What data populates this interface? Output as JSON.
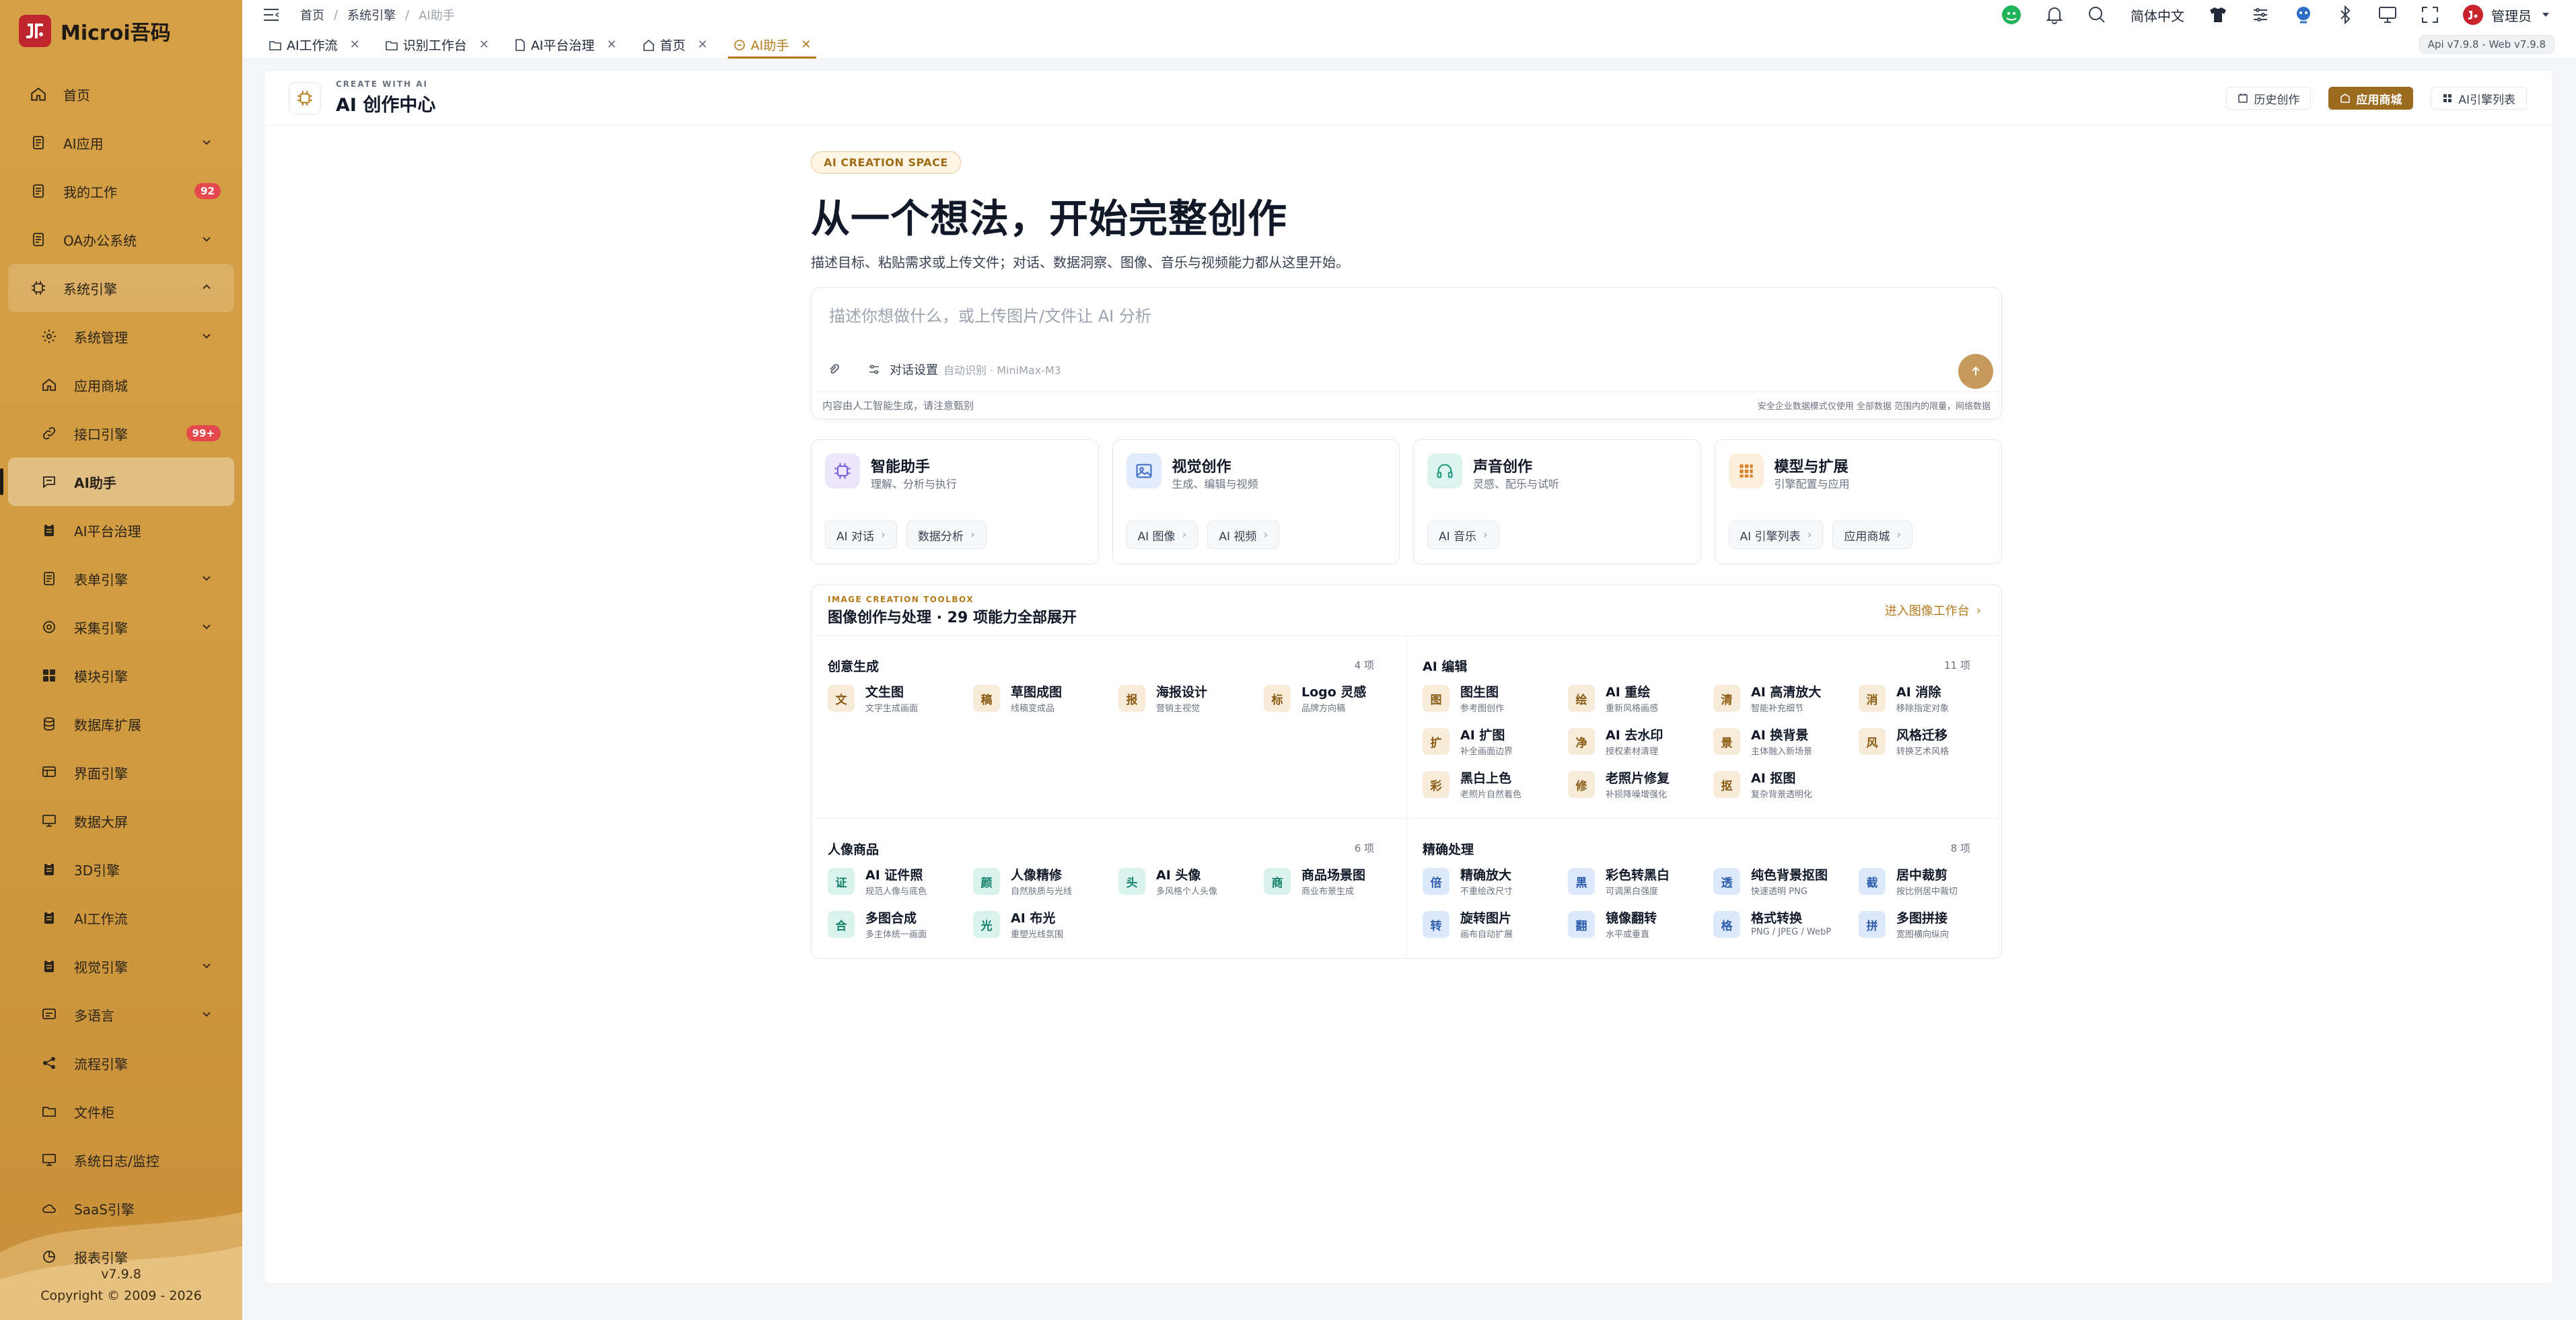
{
  "brand": {
    "name": "Microi吾码"
  },
  "sidebar": {
    "items": [
      {
        "label": "首页",
        "icon": "home-icon"
      },
      {
        "label": "AI应用",
        "icon": "document-icon",
        "chevron": true
      },
      {
        "label": "我的工作",
        "icon": "document-icon",
        "badge": "92"
      },
      {
        "label": "OA办公系统",
        "icon": "document-icon",
        "chevron": true
      },
      {
        "label": "系统引擎",
        "icon": "chip-icon",
        "chevron": true
      },
      {
        "label": "系统管理",
        "icon": "gear-icon",
        "chevron": true
      },
      {
        "label": "应用商城",
        "icon": "home-icon"
      },
      {
        "label": "接口引擎",
        "icon": "link-icon",
        "badge": "99+"
      },
      {
        "label": "AI助手",
        "icon": "chat-icon"
      },
      {
        "label": "AI平台治理",
        "icon": "clipboard-icon"
      },
      {
        "label": "表单引擎",
        "icon": "document-icon",
        "chevron": true
      },
      {
        "label": "采集引擎",
        "icon": "gear-icon",
        "chevron": true
      },
      {
        "label": "模块引擎",
        "icon": "grid-icon"
      },
      {
        "label": "数据库扩展",
        "icon": "database-icon"
      },
      {
        "label": "界面引擎",
        "icon": "layout-icon"
      },
      {
        "label": "数据大屏",
        "icon": "monitor-icon"
      },
      {
        "label": "3D引擎",
        "icon": "clipboard-icon"
      },
      {
        "label": "AI工作流",
        "icon": "clipboard-icon"
      },
      {
        "label": "视觉引擎",
        "icon": "clipboard-icon",
        "chevron": true
      },
      {
        "label": "多语言",
        "icon": "layout-icon",
        "chevron": true
      },
      {
        "label": "流程引擎",
        "icon": "share-icon"
      },
      {
        "label": "文件柜",
        "icon": "folder-icon"
      },
      {
        "label": "系统日志/监控",
        "icon": "monitor-icon"
      },
      {
        "label": "SaaS引擎",
        "icon": "cloud-icon"
      },
      {
        "label": "报表引擎",
        "icon": "chart-icon"
      }
    ],
    "version": "v7.9.8",
    "copyright": "Copyright © 2009 - 2026"
  },
  "topbar": {
    "breadcrumb": [
      "首页",
      "系统引擎",
      "AI助手"
    ],
    "language": "简体中文",
    "user": "管理员"
  },
  "tabs": [
    {
      "label": "AI工作流",
      "icon": "folder-icon"
    },
    {
      "label": "识别工作台",
      "icon": "folder-icon"
    },
    {
      "label": "AI平台治理",
      "icon": "document-icon"
    },
    {
      "label": "首页",
      "icon": "home-icon"
    },
    {
      "label": "AI助手",
      "icon": "chat-icon",
      "active": true
    }
  ],
  "version_pill": "Api v7.9.8 - Web v7.9.8",
  "header": {
    "kicker": "CREATE WITH AI",
    "title": "AI 创作中心",
    "btn_history": "历史创作",
    "btn_store": "应用商城",
    "btn_engines": "AI引擎列表"
  },
  "hero": {
    "pill": "AI CREATION SPACE",
    "title": "从一个想法，开始完整创作",
    "subtitle": "描述目标、粘贴需求或上传文件；对话、数据洞察、图像、音乐与视频能力都从这里开始。"
  },
  "input": {
    "placeholder": "描述你想做什么，或上传图片/文件让 AI 分析",
    "settings_label": "对话设置",
    "settings_value": "自动识别 · MiniMax-M3",
    "footer_left": "内容由人工智能生成，请注意甄别",
    "footer_right": "安全企业数据模式仅使用 全部数据 范围内的限量，网络数据"
  },
  "cards": [
    {
      "title": "智能助手",
      "subtitle": "理解、分析与执行",
      "icon": "chip-icon",
      "color": "#ece6fb",
      "icolor": "#7c5cd6",
      "chips": [
        "AI 对话",
        "数据分析"
      ]
    },
    {
      "title": "视觉创作",
      "subtitle": "生成、编辑与视频",
      "icon": "image-icon",
      "color": "#e2ebfb",
      "icolor": "#3f6fc7",
      "chips": [
        "AI 图像",
        "AI 视频"
      ]
    },
    {
      "title": "声音创作",
      "subtitle": "灵感、配乐与试听",
      "icon": "headphones-icon",
      "color": "#dcf3ee",
      "icolor": "#1f9a80",
      "chips": [
        "AI 音乐"
      ]
    },
    {
      "title": "模型与扩展",
      "subtitle": "引擎配置与应用",
      "icon": "grid-icon",
      "color": "#fbeedd",
      "icolor": "#d9822b",
      "chips": [
        "AI 引擎列表",
        "应用商城"
      ]
    }
  ],
  "toolbox": {
    "kicker": "IMAGE CREATION TOOLBOX",
    "title": "图像创作与处理 · 29 项能力全部展开",
    "link": "进入图像工作台",
    "sections": [
      {
        "name": "创意生成",
        "count": "4 项",
        "items": [
          {
            "glyph": "文",
            "name": "文生图",
            "desc": "文字生成画面",
            "tone": "warm"
          },
          {
            "glyph": "稿",
            "name": "草图成图",
            "desc": "线稿变成品",
            "tone": "warm"
          },
          {
            "glyph": "报",
            "name": "海报设计",
            "desc": "营销主视觉",
            "tone": "warm"
          },
          {
            "glyph": "标",
            "name": "Logo 灵感",
            "desc": "品牌方向稿",
            "tone": "warm"
          }
        ]
      },
      {
        "name": "AI 编辑",
        "count": "11 项",
        "items": [
          {
            "glyph": "图",
            "name": "图生图",
            "desc": "参考图创作",
            "tone": "warm"
          },
          {
            "glyph": "绘",
            "name": "AI 重绘",
            "desc": "重新风格画感",
            "tone": "warm"
          },
          {
            "glyph": "清",
            "name": "AI 高清放大",
            "desc": "智能补充细节",
            "tone": "warm"
          },
          {
            "glyph": "消",
            "name": "AI 消除",
            "desc": "移除指定对象",
            "tone": "warm"
          },
          {
            "glyph": "扩",
            "name": "AI 扩图",
            "desc": "补全画面边界",
            "tone": "warm"
          },
          {
            "glyph": "净",
            "name": "AI 去水印",
            "desc": "授权素材清理",
            "tone": "warm"
          },
          {
            "glyph": "景",
            "name": "AI 换背景",
            "desc": "主体融入新场景",
            "tone": "warm"
          },
          {
            "glyph": "风",
            "name": "风格迁移",
            "desc": "转换艺术风格",
            "tone": "warm"
          },
          {
            "glyph": "彩",
            "name": "黑白上色",
            "desc": "老照片自然着色",
            "tone": "warm"
          },
          {
            "glyph": "修",
            "name": "老照片修复",
            "desc": "补损降噪增强化",
            "tone": "warm"
          },
          {
            "glyph": "抠",
            "name": "AI 抠图",
            "desc": "复杂背景透明化",
            "tone": "warm"
          }
        ]
      },
      {
        "name": "人像商品",
        "count": "6 项",
        "items": [
          {
            "glyph": "证",
            "name": "AI 证件照",
            "desc": "规范人像与底色",
            "tone": "teal"
          },
          {
            "glyph": "颜",
            "name": "人像精修",
            "desc": "自然肤质与光线",
            "tone": "teal"
          },
          {
            "glyph": "头",
            "name": "AI 头像",
            "desc": "多风格个人头像",
            "tone": "teal"
          },
          {
            "glyph": "商",
            "name": "商品场景图",
            "desc": "商业布景生成",
            "tone": "teal"
          },
          {
            "glyph": "合",
            "name": "多图合成",
            "desc": "多主体统一画面",
            "tone": "teal"
          },
          {
            "glyph": "光",
            "name": "AI 布光",
            "desc": "重塑光线氛围",
            "tone": "teal"
          }
        ]
      },
      {
        "name": "精确处理",
        "count": "8 项",
        "items": [
          {
            "glyph": "倍",
            "name": "精确放大",
            "desc": "不重绘改尺寸",
            "tone": "blue"
          },
          {
            "glyph": "黑",
            "name": "彩色转黑白",
            "desc": "可调黑白强度",
            "tone": "blue"
          },
          {
            "glyph": "透",
            "name": "纯色背景抠图",
            "desc": "快速透明 PNG",
            "tone": "blue"
          },
          {
            "glyph": "截",
            "name": "居中裁剪",
            "desc": "按比例居中裁切",
            "tone": "blue"
          },
          {
            "glyph": "转",
            "name": "旋转图片",
            "desc": "画布自动扩展",
            "tone": "blue"
          },
          {
            "glyph": "翻",
            "name": "镜像翻转",
            "desc": "水平或垂直",
            "tone": "blue"
          },
          {
            "glyph": "格",
            "name": "格式转换",
            "desc": "PNG / JPEG / WebP",
            "tone": "blue"
          },
          {
            "glyph": "拼",
            "name": "多图拼接",
            "desc": "宽图横向纵向",
            "tone": "blue"
          }
        ]
      }
    ]
  }
}
